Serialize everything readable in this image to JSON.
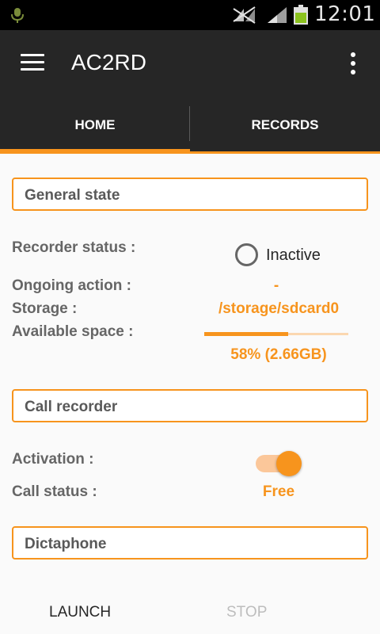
{
  "status_bar": {
    "time": "12:01",
    "icons": [
      "mic-icon",
      "signal-muted-icon",
      "signal-icon",
      "battery-icon"
    ]
  },
  "app_bar": {
    "title": "AC2RD",
    "icons": [
      "menu-icon",
      "overflow-icon"
    ]
  },
  "tabs": [
    {
      "label": "HOME",
      "selected": true
    },
    {
      "label": "RECORDS",
      "selected": false
    }
  ],
  "general_state": {
    "header": "General state",
    "recorder_status_label": "Recorder status :",
    "recorder_status_value": "Inactive",
    "ongoing_action_label": "Ongoing action :",
    "ongoing_action_value": "-",
    "storage_label": "Storage :",
    "storage_value": "/storage/sdcard0",
    "available_space_label": "Available space :",
    "available_space_value": "58% (2.66GB)",
    "available_space_fraction": 0.58
  },
  "call_recorder": {
    "header": "Call recorder",
    "activation_label": "Activation :",
    "activation_on": true,
    "call_status_label": "Call status :",
    "call_status_value": "Free"
  },
  "dictaphone": {
    "header": "Dictaphone"
  },
  "actions": {
    "launch_label": "LAUNCH",
    "stop_label": "STOP"
  },
  "colors": {
    "accent": "#f7941d",
    "bar": "#262626",
    "background": "#fafafa"
  }
}
